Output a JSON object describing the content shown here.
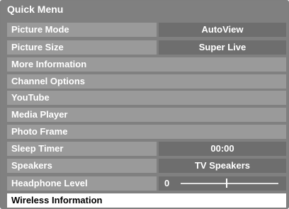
{
  "menu": {
    "title": "Quick Menu",
    "items": [
      {
        "label": "Picture Mode",
        "value": "AutoView"
      },
      {
        "label": "Picture Size",
        "value": "Super Live"
      },
      {
        "label": "More Information"
      },
      {
        "label": "Channel Options"
      },
      {
        "label": "YouTube"
      },
      {
        "label": "Media Player"
      },
      {
        "label": "Photo Frame"
      },
      {
        "label": "Sleep Timer",
        "value": "00:00"
      },
      {
        "label": "Speakers",
        "value": "TV Speakers"
      },
      {
        "label": "Headphone Level",
        "slider_value": "0",
        "slider_level": 0.47
      },
      {
        "label": "Wireless Information",
        "selected": true
      }
    ]
  },
  "colors": {
    "background": "#808080",
    "row": "#9a9a9a",
    "value_cell": "#6e6e6e",
    "selected_row": "#ffffff",
    "text": "#ffffff",
    "selected_text": "#000000"
  }
}
